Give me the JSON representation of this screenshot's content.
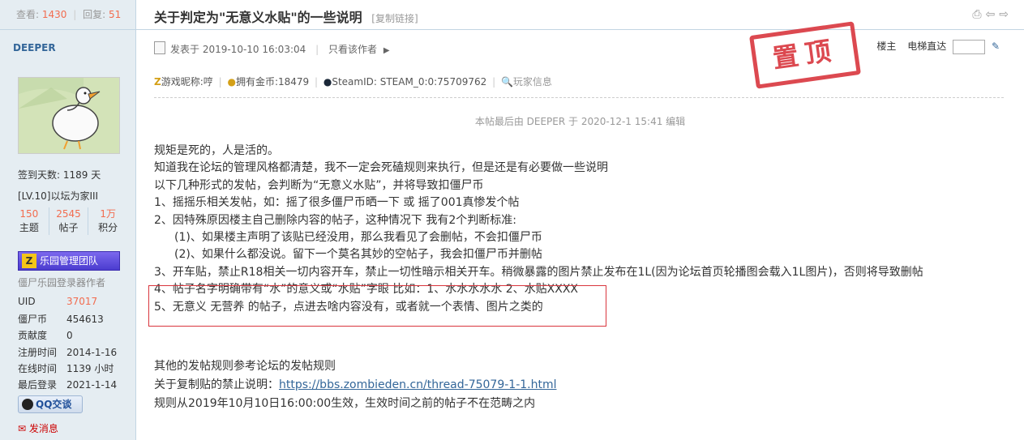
{
  "stats": {
    "view_label": "查看:",
    "views": "1430",
    "sep": "|",
    "reply_label": "回复:",
    "replies": "51"
  },
  "author": {
    "name": "DEEPER",
    "signin": "签到天数: 1189 天",
    "level": "[LV.10]以坛为家III",
    "counts": [
      {
        "value": "150",
        "label": "主题"
      },
      {
        "value": "2545",
        "label": "帖子"
      },
      {
        "value": "1万",
        "label": "积分"
      }
    ],
    "team_badge": "乐园管理团队",
    "role": "僵尸乐园登录器作者",
    "info": [
      {
        "key": "UID",
        "value": "37017",
        "highlight": true
      },
      {
        "key": "僵尸币",
        "value": "454613"
      },
      {
        "key": "贡献度",
        "value": "0"
      },
      {
        "key": "注册时间",
        "value": "2014-1-16"
      },
      {
        "key": "在线时间",
        "value": "1139 小时"
      },
      {
        "key": "最后登录",
        "value": "2021-1-14"
      }
    ],
    "qq_label": "QQ交谈",
    "message_label": "发消息"
  },
  "post": {
    "title": "关于判定为\"无意义水贴\"的一些说明",
    "copy_link": "[复制链接]",
    "posted_at": "发表于 2019-10-10 16:03:04",
    "only_author": "只看该作者",
    "floor": "楼主",
    "elevator": "电梯直达",
    "stamp": "置顶",
    "game_nick": "游戏昵称:哼",
    "coins": "拥有金币:18479",
    "steam": "SteamID: STEAM_0:0:75709762",
    "player_info": "玩家信息",
    "edit_note": "本帖最后由 DEEPER 于 2020-12-1 15:41 编辑",
    "lines": [
      "规矩是死的，人是活的。",
      "知道我在论坛的管理风格都清楚，我不一定会死磕规则来执行，但是还是有必要做一些说明",
      "以下几种形式的发帖，会判断为“无意义水贴”，并将导致扣僵尸币",
      "1、摇摇乐相关发帖，如：摇了很多僵尸币晒一下 或 摇了001真惨发个帖",
      "2、因特殊原因楼主自己删除内容的帖子，这种情况下 我有2个判断标准:",
      "(1)、如果楼主声明了该贴已经没用，那么我看见了会删帖，不会扣僵尸币",
      "(2)、如果什么都没说。留下一个莫名其妙的空帖子，我会扣僵尸币并删帖",
      "3、开车贴，禁止R18相关一切内容开车，禁止一切性暗示相关开车。稍微暴露的图片禁止发布在1L(因为论坛首页轮播图会载入1L图片)，否则将导致删帖",
      "4、帖子名字明确带有“水”的意义或“水贴”字眼 比如：1、水水水水水 2、水贴XXXX",
      "5、无意义 无营养 的帖子，点进去啥内容没有，或者就一个表情、图片之类的"
    ],
    "footer_lines": [
      "其他的发帖规则参考论坛的发帖规则",
      "关于复制贴的禁止说明："
    ],
    "link": "https://bbs.zombieden.cn/thread-75079-1-1.html",
    "last_line": "规则从2019年10月10日16:00:00生效，生效时间之前的帖子不在范畴之内"
  }
}
